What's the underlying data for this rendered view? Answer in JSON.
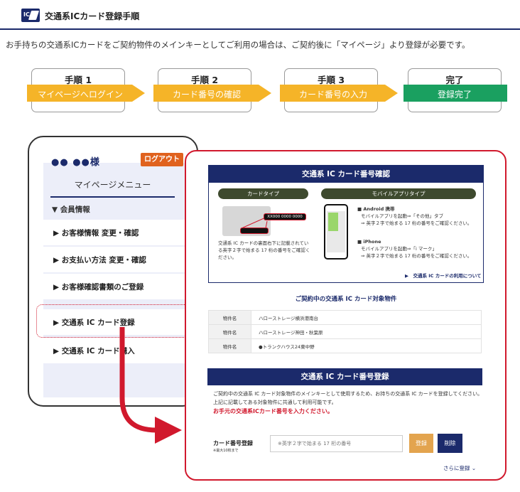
{
  "header": {
    "logo_text": "IC",
    "title": "交通系ICカード登録手順"
  },
  "intro": "お手持ちの交通系ICカードをご契約物件のメインキーとしてご利用の場合は、ご契約後に「マイページ」より登録が必要です。",
  "steps": [
    {
      "num": "手順 1",
      "label": "マイページへログイン",
      "color": "#f5b428"
    },
    {
      "num": "手順 2",
      "label": "カード番号の確認",
      "color": "#f5b428"
    },
    {
      "num": "手順 3",
      "label": "カード番号の入力",
      "color": "#f5b428"
    },
    {
      "num": "完了",
      "label": "登録完了",
      "color": "#1aa060"
    }
  ],
  "mypage": {
    "user": "●● ●●様",
    "logout": "ログアウト",
    "menu_title": "マイページメニュー",
    "member_section": "▼ 会員情報",
    "items": [
      "▶ お客様情報 変更・確認",
      "▶ お支払い方法 変更・確認",
      "▶ お客様確認書類のご登録",
      "▶ 交通系 IC カード登録",
      "▶ 交通系 IC カード購入"
    ]
  },
  "confirm": {
    "title": "交通系 IC カード番号確認",
    "card_type": "カードタイプ",
    "mobile_type": "モバイルアプリタイプ",
    "card_number_sample": "XX000 0000 0000 0000",
    "card_desc": "交通系 IC カードの裏面右下に記載されている英字２字で始まる 17 桁の番号をご確認ください。",
    "android_head": "■ Android 携帯",
    "android_l1": "モバイルアプリを起動⇒「その他」タブ",
    "android_l2": "⇒ 英字２字で始まる 17 桁の番号をご確認ください。",
    "iphone_head": "■ iPhone",
    "iphone_l1": "モバイルアプリを起動⇒「i マーク」",
    "iphone_l2": "⇒ 英字２字で始まる 17 桁の番号をご確認ください。",
    "link": "▶　交通系 IC カードの利用について"
  },
  "target": {
    "title": "ご契約中の交通系 IC カード対象物件",
    "rows": [
      {
        "key": "物件名",
        "value": "ハローストレージ横浜港南台"
      },
      {
        "key": "物件名",
        "value": "ハローストレージ神田・秋葉原"
      },
      {
        "key": "物件名",
        "value": "●トランクハウス24東中野"
      }
    ]
  },
  "register": {
    "title": "交通系 IC カード番号登録",
    "desc1": "ご契約中の交通系 IC カード対象物件のメインキーとして使用するため、お持ちの交通系 IC カードを登録してください。",
    "desc2": "上記に記載してある対象物件に共通して利用可能です。",
    "warn": "お手元の交通系ICカード番号を入力ください。",
    "label": "カード番号登録",
    "note": "※最大10枚まで",
    "placeholder": "※英字２字で始まる 17 桁の番号",
    "btn_register": "登録",
    "btn_delete": "削除",
    "more": "さらに登録 ⌄"
  }
}
